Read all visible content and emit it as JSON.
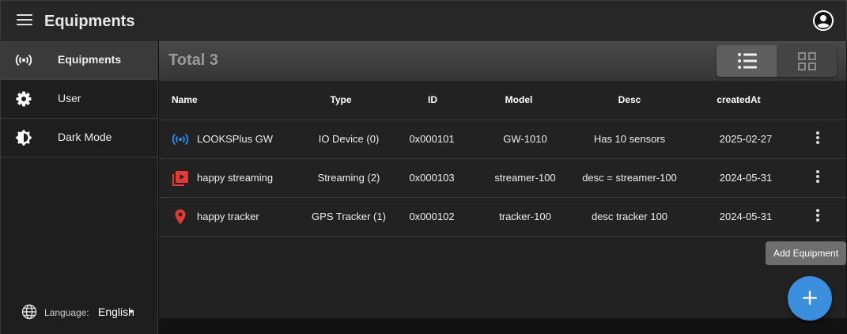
{
  "appbar": {
    "title": "Equipments"
  },
  "sidebar": {
    "items": [
      {
        "label": "Equipments",
        "icon": "broadcast-icon",
        "active": true
      },
      {
        "label": "User",
        "icon": "gear-icon"
      },
      {
        "label": "Dark Mode",
        "icon": "brightness-icon"
      }
    ],
    "language": {
      "label": "Language:",
      "value": "English"
    }
  },
  "toolbar": {
    "total": "Total 3",
    "view_modes": [
      "list-view-icon",
      "grid-view-icon"
    ],
    "active_view": "list"
  },
  "table": {
    "columns": [
      "Name",
      "Type",
      "ID",
      "Model",
      "Desc",
      "createdAt"
    ],
    "rows": [
      {
        "name": "LOOKSPlus GW",
        "icon": "broadcast-icon",
        "type": "IO Device (0)",
        "id": "0x000101",
        "model": "GW-1010",
        "desc": "Has 10 sensors",
        "created": "2025-02-27"
      },
      {
        "name": "happy streaming",
        "icon": "video-library-icon",
        "type": "Streaming (2)",
        "id": "0x000103",
        "model": "streamer-100",
        "desc": "desc = streamer-100",
        "created": "2024-05-31"
      },
      {
        "name": "happy tracker",
        "icon": "location-pin-icon",
        "type": "GPS Tracker (1)",
        "id": "0x000102",
        "model": "tracker-100",
        "desc": "desc tracker 100",
        "created": "2024-05-31"
      }
    ]
  },
  "tooltip": "Add Equipment",
  "fab": {
    "label": "+"
  },
  "colors": {
    "accent": "#3b8edb",
    "broadcast_icon": "#2d8cf0",
    "red_icon": "#e53935"
  }
}
